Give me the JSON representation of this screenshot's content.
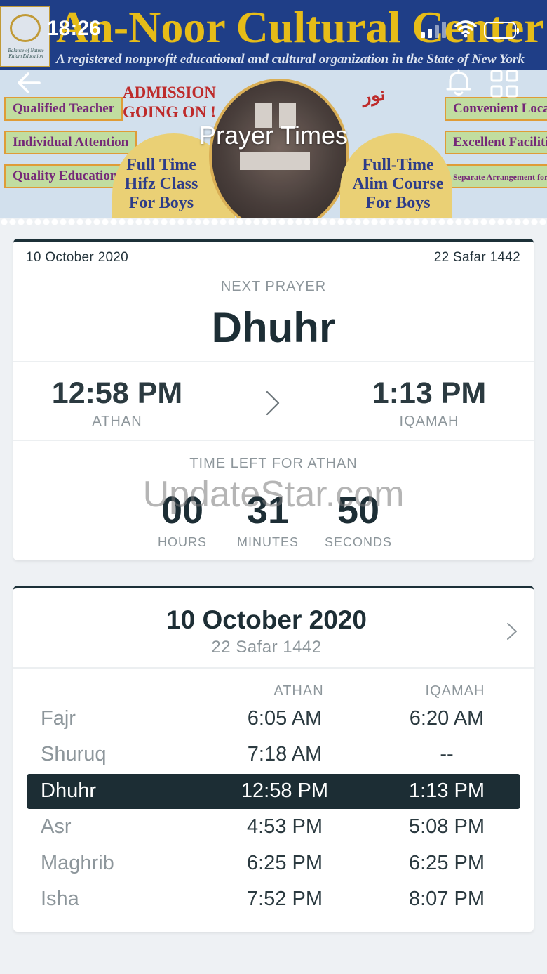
{
  "status_bar": {
    "time": "18:26"
  },
  "banner": {
    "name": "An-Noor Cultural Center",
    "subtitle": "A registered nonprofit educational and cultural organization in the State of New York",
    "logo_text": "Balance of Nature Kalam Education",
    "tags_left": [
      "Qualified Teacher",
      "Individual Attention",
      "Quality Education"
    ],
    "tags_right": [
      "Convenient Location",
      "Excellent Facilities",
      "Separate Arrangement for Sisters"
    ],
    "admission": "ADMISSION GOING ON !",
    "hifz": "Full Time Hifz Class For Boys",
    "alim": "Full-Time Alim Course For Boys"
  },
  "nav": {
    "title": "Prayer Times"
  },
  "next_prayer_card": {
    "date": "10 October 2020",
    "hijri": "22 Safar 1442",
    "next_label": "NEXT PRAYER",
    "next_name": "Dhuhr",
    "athan_time": "12:58 PM",
    "athan_label": "ATHAN",
    "iqamah_time": "1:13 PM",
    "iqamah_label": "IQAMAH",
    "time_left_label": "TIME LEFT FOR ATHAN",
    "hours": "00",
    "hours_label": "HOURS",
    "minutes": "31",
    "minutes_label": "MINUTES",
    "seconds": "50",
    "seconds_label": "SECONDS",
    "watermark": "UpdateStar.com"
  },
  "schedule_card": {
    "date": "10 October 2020",
    "hijri": "22 Safar 1442",
    "col_athan": "ATHAN",
    "col_iqamah": "IQAMAH",
    "rows": [
      {
        "name": "Fajr",
        "athan": "6:05 AM",
        "iqamah": "6:20 AM"
      },
      {
        "name": "Shuruq",
        "athan": "7:18 AM",
        "iqamah": "--"
      },
      {
        "name": "Dhuhr",
        "athan": "12:58 PM",
        "iqamah": "1:13 PM"
      },
      {
        "name": "Asr",
        "athan": "4:53 PM",
        "iqamah": "5:08 PM"
      },
      {
        "name": "Maghrib",
        "athan": "6:25 PM",
        "iqamah": "6:25 PM"
      },
      {
        "name": "Isha",
        "athan": "7:52 PM",
        "iqamah": "8:07 PM"
      }
    ]
  },
  "colors": {
    "dark": "#1c2d34",
    "muted": "#8d969b",
    "background": "#eef1f4",
    "banner_gold": "#f0c419",
    "banner_blue": "#21418d"
  }
}
